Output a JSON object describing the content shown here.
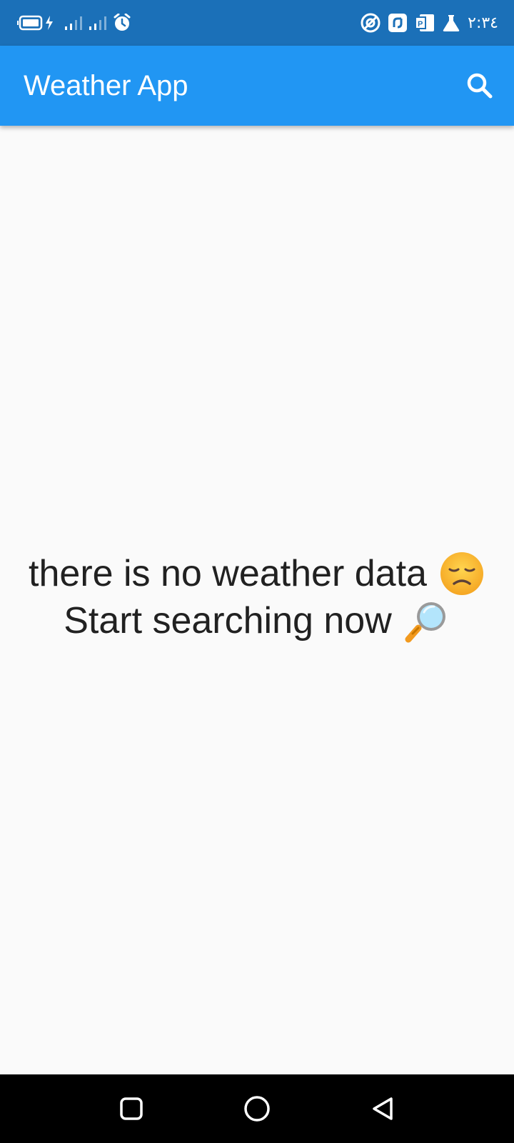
{
  "status_bar": {
    "time": "٢:٣٤",
    "left_icons": [
      "battery-charging-icon",
      "signal-icon",
      "signal-icon",
      "alarm-icon"
    ],
    "right_icons": [
      "app-notification-icon",
      "app-notification-icon",
      "app-notification-icon",
      "lab-flask-icon"
    ]
  },
  "app_bar": {
    "title": "Weather App",
    "search_icon": "search-icon",
    "color": "#2196f3"
  },
  "empty_state": {
    "line1": "there is no weather data",
    "line1_emoji": "disappointed-face-icon",
    "line2": "Start searching now",
    "line2_emoji": "magnifying-glass-icon"
  },
  "nav_bar": {
    "buttons": [
      "recent-apps-icon",
      "home-icon",
      "back-icon"
    ]
  },
  "colors": {
    "status_bar": "#1b70b8",
    "app_bar": "#2196f3",
    "background": "#fafafa",
    "text": "#212121"
  }
}
